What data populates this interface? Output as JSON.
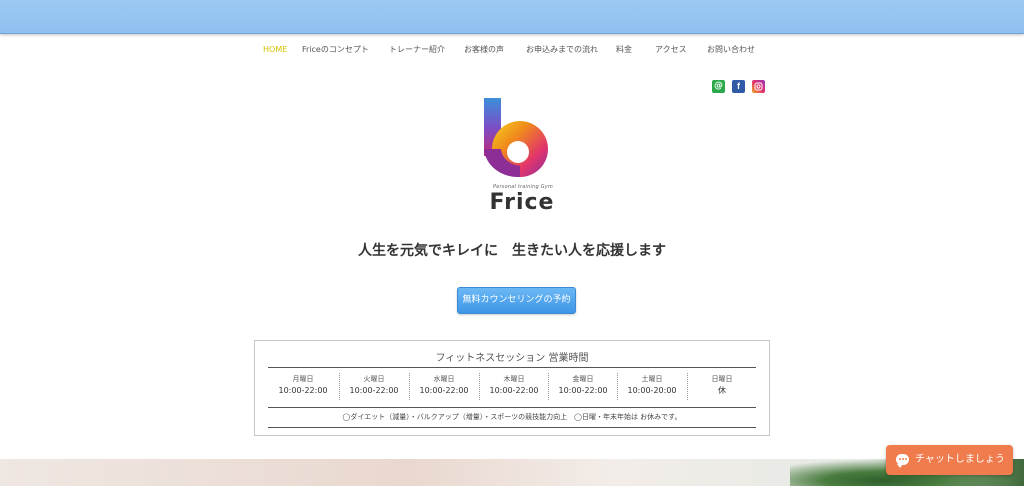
{
  "nav": {
    "items": [
      {
        "label": "HOME",
        "active": true
      },
      {
        "label": "Friceのコンセプト"
      },
      {
        "label": "トレーナー紹介"
      },
      {
        "label": "お客様の声"
      },
      {
        "label": "お申込みまでの流れ"
      },
      {
        "label": "料金"
      },
      {
        "label": "アクセス"
      },
      {
        "label": "お問い合わせ"
      }
    ]
  },
  "social": {
    "line_glyph": "@",
    "facebook_glyph": "f",
    "icons": [
      "line-icon",
      "facebook-icon",
      "instagram-icon"
    ]
  },
  "logo": {
    "tagline": "Personal training Gym",
    "wordmark": "Frice"
  },
  "hero": {
    "tagline": "人生を元気でキレイに　生きたい人を応援します",
    "cta_label": "無料カウンセリングの予約"
  },
  "hours": {
    "title": "フィットネスセッション 営業時間",
    "days": [
      {
        "day": "月曜日",
        "time": "10:00-22:00"
      },
      {
        "day": "火曜日",
        "time": "10:00-22:00"
      },
      {
        "day": "水曜日",
        "time": "10:00-22:00"
      },
      {
        "day": "木曜日",
        "time": "10:00-22:00"
      },
      {
        "day": "金曜日",
        "time": "10:00-22:00"
      },
      {
        "day": "土曜日",
        "time": "10:00-20:00"
      },
      {
        "day": "日曜日",
        "time": "休"
      }
    ],
    "note": "◯ダイエット（減量）・バルクアップ（増量）・スポーツの競技能力向上　◯日曜・年末年始は お休みです。"
  },
  "chat": {
    "label": "チャットしましょう"
  },
  "colors": {
    "accent_blue": "#3d96e6",
    "nav_active": "#d6c200",
    "chat_orange": "#f07b4d",
    "top_band": "#9cc9f3"
  }
}
